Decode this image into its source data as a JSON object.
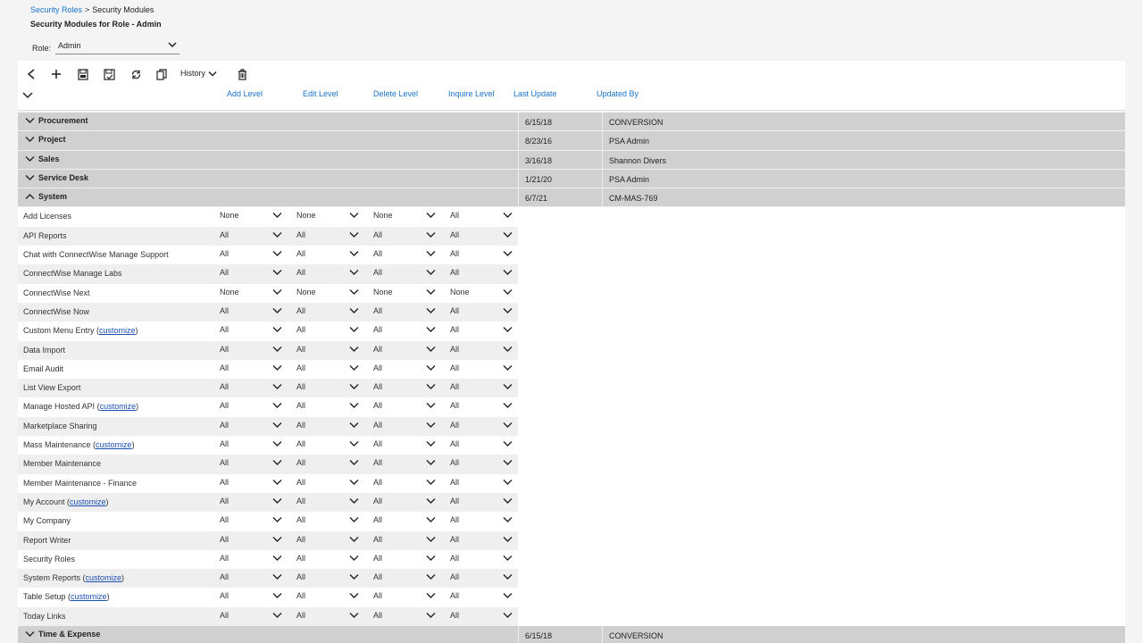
{
  "breadcrumb": {
    "root": "Security Roles",
    "current": "Security Modules"
  },
  "page_title": "Security Modules for Role - Admin",
  "role": {
    "label": "Role:",
    "value": "Admin"
  },
  "toolbar": {
    "history_label": "History"
  },
  "columns": {
    "add": "Add Level",
    "edit": "Edit Level",
    "delete": "Delete Level",
    "inquire": "Inquire Level",
    "last_update": "Last Update",
    "updated_by": "Updated By"
  },
  "groups_top": [
    {
      "name": "Procurement",
      "date": "6/15/18",
      "by": "CONVERSION"
    },
    {
      "name": "Project",
      "date": "8/23/16",
      "by": "PSA Admin"
    },
    {
      "name": "Sales",
      "date": "3/16/18",
      "by": "Shannon Divers"
    },
    {
      "name": "Service Desk",
      "date": "1/21/20",
      "by": "PSA Admin"
    },
    {
      "name": "System",
      "date": "6/7/21",
      "by": "CM-MAS-769"
    }
  ],
  "system_items": [
    {
      "name": "Add Licenses",
      "customize": "",
      "add": "None",
      "edit": "None",
      "delete": "None",
      "inquire": "All"
    },
    {
      "name": "API Reports",
      "customize": "",
      "add": "All",
      "edit": "All",
      "delete": "All",
      "inquire": "All"
    },
    {
      "name": "Chat with ConnectWise Manage Support",
      "customize": "",
      "add": "All",
      "edit": "All",
      "delete": "All",
      "inquire": "All"
    },
    {
      "name": "ConnectWise Manage Labs",
      "customize": "",
      "add": "All",
      "edit": "All",
      "delete": "All",
      "inquire": "All"
    },
    {
      "name": "ConnectWise Next",
      "customize": "",
      "add": "None",
      "edit": "None",
      "delete": "None",
      "inquire": "None"
    },
    {
      "name": "ConnectWise Now",
      "customize": "",
      "add": "All",
      "edit": "All",
      "delete": "All",
      "inquire": "All"
    },
    {
      "name": "Custom Menu Entry ",
      "customize": "customize",
      "add": "All",
      "edit": "All",
      "delete": "All",
      "inquire": "All"
    },
    {
      "name": "Data Import",
      "customize": "",
      "add": "All",
      "edit": "All",
      "delete": "All",
      "inquire": "All"
    },
    {
      "name": "Email Audit",
      "customize": "",
      "add": "All",
      "edit": "All",
      "delete": "All",
      "inquire": "All"
    },
    {
      "name": "List View Export",
      "customize": "",
      "add": "All",
      "edit": "All",
      "delete": "All",
      "inquire": "All"
    },
    {
      "name": "Manage Hosted API ",
      "customize": "customize",
      "add": "All",
      "edit": "All",
      "delete": "All",
      "inquire": "All"
    },
    {
      "name": "Marketplace Sharing",
      "customize": "",
      "add": "All",
      "edit": "All",
      "delete": "All",
      "inquire": "All"
    },
    {
      "name": "Mass Maintenance ",
      "customize": "customize",
      "add": "All",
      "edit": "All",
      "delete": "All",
      "inquire": "All"
    },
    {
      "name": "Member Maintenance",
      "customize": "",
      "add": "All",
      "edit": "All",
      "delete": "All",
      "inquire": "All"
    },
    {
      "name": "Member Maintenance - Finance",
      "customize": "",
      "add": "All",
      "edit": "All",
      "delete": "All",
      "inquire": "All"
    },
    {
      "name": "My Account ",
      "customize": "customize",
      "add": "All",
      "edit": "All",
      "delete": "All",
      "inquire": "All"
    },
    {
      "name": "My Company",
      "customize": "",
      "add": "All",
      "edit": "All",
      "delete": "All",
      "inquire": "All"
    },
    {
      "name": "Report Writer",
      "customize": "",
      "add": "All",
      "edit": "All",
      "delete": "All",
      "inquire": "All"
    },
    {
      "name": "Security Roles",
      "customize": "",
      "add": "All",
      "edit": "All",
      "delete": "All",
      "inquire": "All"
    },
    {
      "name": "System Reports ",
      "customize": "customize",
      "add": "All",
      "edit": "All",
      "delete": "All",
      "inquire": "All"
    },
    {
      "name": "Table Setup ",
      "customize": "customize",
      "add": "All",
      "edit": "All",
      "delete": "All",
      "inquire": "All"
    },
    {
      "name": "Today Links",
      "customize": "",
      "add": "All",
      "edit": "All",
      "delete": "All",
      "inquire": "All"
    }
  ],
  "groups_bottom": [
    {
      "name": "Time & Expense",
      "date": "6/15/18",
      "by": "CONVERSION"
    }
  ]
}
